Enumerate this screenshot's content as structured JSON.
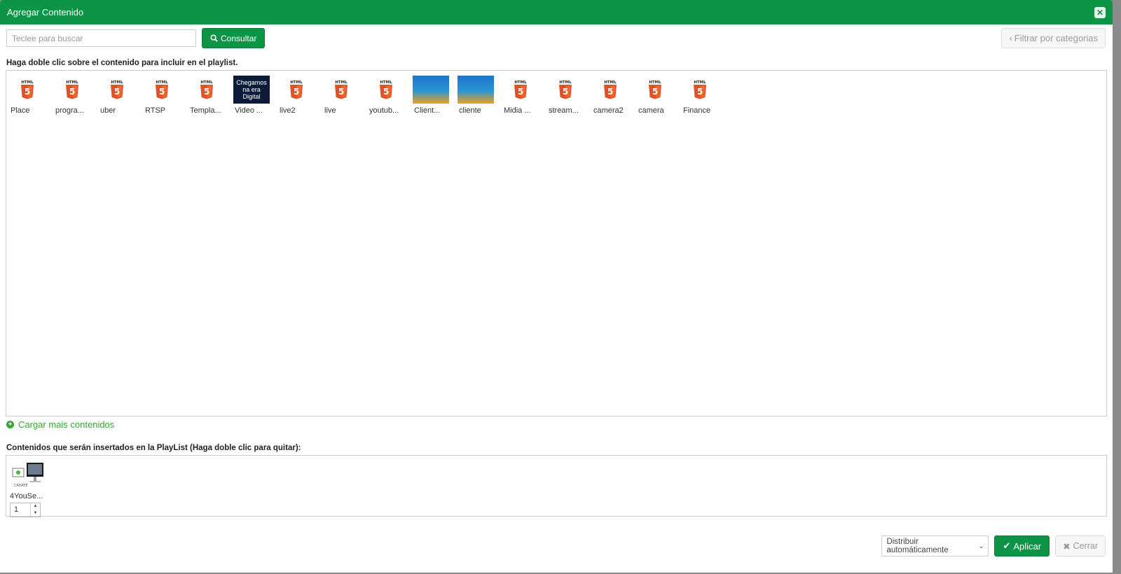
{
  "dialog": {
    "title": "Agregar Contenido",
    "close_icon": "close-icon"
  },
  "search": {
    "placeholder": "Teclee para buscar",
    "value": "",
    "button_label": "Consultar",
    "button_icon": "search-icon"
  },
  "filter": {
    "label": "Filtrar por categorias",
    "icon": "chevron-left-icon"
  },
  "instructions": "Haga doble clic sobre el contenido para incluir en el playlist.",
  "contents": [
    {
      "label": "Place",
      "thumb": "html5"
    },
    {
      "label": "progra...",
      "thumb": "html5"
    },
    {
      "label": "uber",
      "thumb": "html5"
    },
    {
      "label": "RTSP",
      "thumb": "html5"
    },
    {
      "label": "Templa...",
      "thumb": "html5"
    },
    {
      "label": "Video ...",
      "thumb": "dark",
      "thumb_text": "Chegamos na era Digital"
    },
    {
      "label": "live2",
      "thumb": "html5"
    },
    {
      "label": "live",
      "thumb": "html5"
    },
    {
      "label": "youtub...",
      "thumb": "html5"
    },
    {
      "label": "Client...",
      "thumb": "banner"
    },
    {
      "label": "cliente",
      "thumb": "banner"
    },
    {
      "label": "Midia ...",
      "thumb": "html5"
    },
    {
      "label": "stream...",
      "thumb": "html5"
    },
    {
      "label": "camera2",
      "thumb": "html5"
    },
    {
      "label": "camera",
      "thumb": "html5"
    },
    {
      "label": "Finance",
      "thumb": "html5"
    }
  ],
  "load_more": {
    "label": "Cargar mais contenidos",
    "icon": "plus-circle-icon"
  },
  "insert_section": {
    "label": "Contenidos que serán insertados en la PlayList (Haga doble clic para quitar):",
    "items": [
      {
        "label": "4YouSe...",
        "quantity": "1",
        "thumb_text": "CREATE"
      }
    ]
  },
  "footer": {
    "distribution_select": "Distribuir automáticamente",
    "apply_label": "Aplicar",
    "apply_icon": "check-icon",
    "close_label": "Cerrar",
    "close_icon": "times-icon"
  },
  "colors": {
    "primary": "#0e9447",
    "html5_orange": "#e34f26",
    "link_green": "#3aa335"
  }
}
